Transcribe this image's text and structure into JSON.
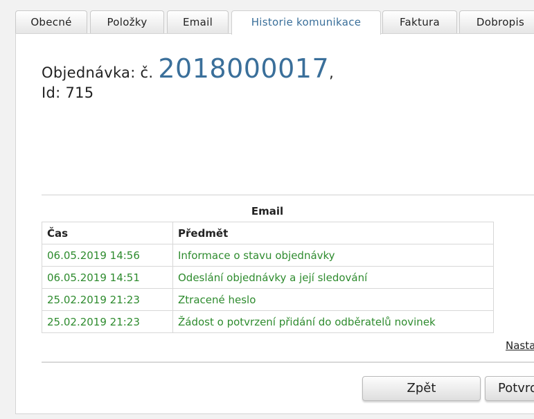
{
  "tabs": [
    {
      "label": "Obecné"
    },
    {
      "label": "Položky"
    },
    {
      "label": "Email"
    },
    {
      "label": "Historie komunikace"
    },
    {
      "label": "Faktura"
    },
    {
      "label": "Dobropis"
    }
  ],
  "active_tab": "Historie komunikace",
  "order": {
    "prefix": "Objednávka: č.",
    "number": "2018000017",
    "suffix": ",",
    "id_line": "Id: 715"
  },
  "email_section": {
    "title": "Email",
    "columns": [
      "Čas",
      "Předmět"
    ],
    "rows": [
      {
        "time": "06.05.2019 14:56",
        "subject": "Informace o stavu objednávky"
      },
      {
        "time": "06.05.2019 14:51",
        "subject": "Odeslání objednávky a její sledování"
      },
      {
        "time": "25.02.2019 21:23",
        "subject": "Ztracené heslo"
      },
      {
        "time": "25.02.2019 21:23",
        "subject": "Žádost o potvrzení přidání do odběratelů novinek"
      }
    ],
    "link_text": "Nasta"
  },
  "buttons": {
    "back": "Zpět",
    "confirm": "Potvrd"
  },
  "colors": {
    "accent": "#3a6f9a",
    "row_text": "#2e8b2e"
  }
}
